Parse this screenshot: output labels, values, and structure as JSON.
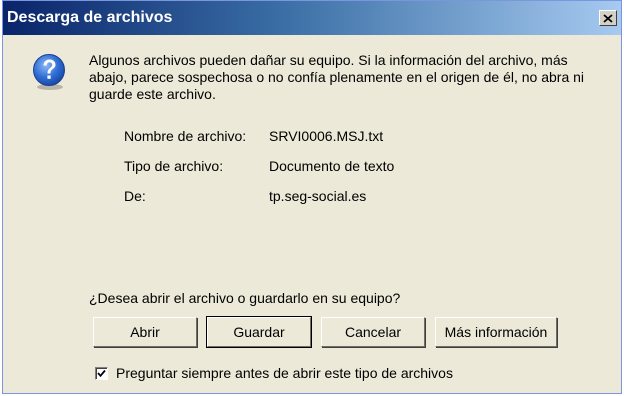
{
  "window": {
    "title": "Descarga de archivos",
    "close_icon": "close-icon"
  },
  "message": {
    "icon": "question-icon",
    "text": "Algunos archivos pueden dañar su equipo. Si la información del archivo, más abajo, parece sospechosa o no confía plenamente en el origen de él, no abra ni guarde este archivo."
  },
  "file_info": [
    {
      "label": "Nombre de archivo:",
      "value": "SRVI0006.MSJ.txt"
    },
    {
      "label": "Tipo de archivo:",
      "value": "Documento de texto"
    },
    {
      "label": "De:",
      "value": "tp.seg-social.es"
    }
  ],
  "question": "¿Desea abrir el archivo o guardarlo en su equipo?",
  "buttons": {
    "open": "Abrir",
    "save": "Guardar",
    "cancel": "Cancelar",
    "more_info": "Más información"
  },
  "checkbox": {
    "label": "Preguntar siempre antes de abrir este tipo de archivos",
    "checked": true
  },
  "colors": {
    "titlebar_start": "#0a246a",
    "titlebar_end": "#a6caf0",
    "dialog_bg": "#ece9d8",
    "icon_blue": "#1e5ec8"
  }
}
